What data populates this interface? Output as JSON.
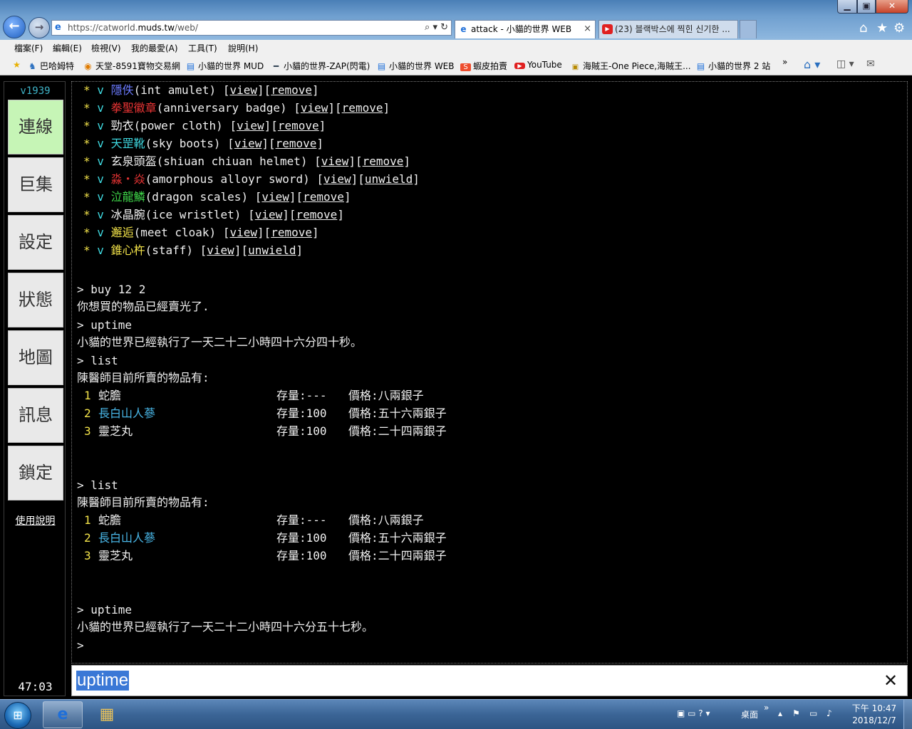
{
  "browser": {
    "address": {
      "prefix": "https://catworld.",
      "host": "muds.tw",
      "suffix": "/web/"
    },
    "address_tools": "⌕ ▾ ↻",
    "tabs": [
      {
        "title": "attack - 小貓的世界 WEB",
        "close": "×"
      },
      {
        "title": "(23) 블랙박스에 찍힌 신기한 ..."
      }
    ],
    "menu": [
      "檔案(F)",
      "編輯(E)",
      "檢視(V)",
      "我的最愛(A)",
      "工具(T)",
      "說明(H)"
    ],
    "favorites": [
      "巴哈姆特",
      "天堂-8591寶物交易網",
      "小貓的世界 MUD",
      "小貓的世界-ZAP(閃電)",
      "小貓的世界 WEB",
      "蝦皮拍賣",
      "YouTube",
      "海賊王-One Piece,海賊王...",
      "小貓的世界 2 站"
    ],
    "fav_more": "»"
  },
  "app": {
    "version": "v1939",
    "nav": [
      {
        "label": "連線",
        "active": true
      },
      {
        "label": "巨集"
      },
      {
        "label": "設定"
      },
      {
        "label": "狀態"
      },
      {
        "label": "地圖"
      },
      {
        "label": "訊息"
      },
      {
        "label": "鎖定"
      }
    ],
    "help_link": "使用說明",
    "timer": "47:03",
    "equipment": [
      {
        "zh": "隱佚",
        "en": "(int amulet) ",
        "action": "remove",
        "color": "#6b7bff"
      },
      {
        "zh": "拳聖徽章",
        "en": "(anniversary badge) ",
        "action": "remove",
        "color": "#e83434"
      },
      {
        "zh": "勁衣",
        "en": "(power cloth) ",
        "action": "remove",
        "color": "#f0f0f0"
      },
      {
        "zh": "天罡靴",
        "en": "(sky boots) ",
        "action": "remove",
        "color": "#3fd9e0"
      },
      {
        "zh": "玄泉頭盔",
        "en": "(shiuan chiuan helmet) ",
        "action": "remove",
        "color": "#f0f0f0"
      },
      {
        "zh": "淼・焱",
        "en": "(amorphous alloyr sword) ",
        "action": "unwield",
        "color": "#e83434"
      },
      {
        "zh": "泣龍鱗",
        "en": "(dragon scales) ",
        "action": "remove",
        "color": "#3fd94a"
      },
      {
        "zh": "冰晶腕",
        "en": "(ice wristlet) ",
        "action": "remove",
        "color": "#f0f0f0"
      },
      {
        "zh": "邂逅",
        "en": "(meet cloak) ",
        "action": "remove",
        "color": "#f4e44a"
      },
      {
        "zh": "錐心杵",
        "en": "(staff) ",
        "action": "unwield",
        "color": "#f4e44a"
      }
    ],
    "equip_star": "*",
    "equip_check": "v",
    "equip_view": "view",
    "log": {
      "cmd_buy": "> buy 12 2",
      "buy_result": "你想買的物品已經賣光了.",
      "cmd_uptime1": "> uptime",
      "uptime1": "小貓的世界已經執行了一天二十二小時四十六分四十秒。",
      "cmd_list1": "> list",
      "list_header1": "陳醫師目前所賣的物品有:",
      "cmd_list2": "> list",
      "list_header2": "陳醫師目前所賣的物品有:",
      "cmd_uptime2": "> uptime",
      "uptime2": "小貓的世界已經執行了一天二十二小時四十六分五十七秒。",
      "prompt": ">"
    },
    "shop_items": [
      {
        "no": "1",
        "name": "蛇膽",
        "stock": "存量:---",
        "price": "價格:八兩銀子",
        "color": "#f0f0f0"
      },
      {
        "no": "2",
        "name": "長白山人蔘",
        "stock": "存量:100",
        "price": "價格:五十六兩銀子",
        "color": "#49b7e8"
      },
      {
        "no": "3",
        "name": "靈芝丸",
        "stock": "存量:100",
        "price": "價格:二十四兩銀子",
        "color": "#f0f0f0"
      }
    ],
    "input": {
      "value": "uptime",
      "clear": "✕"
    }
  },
  "taskbar": {
    "desktop_label": "桌面",
    "more": "»",
    "time": "下午 10:47",
    "date": "2018/12/7"
  }
}
